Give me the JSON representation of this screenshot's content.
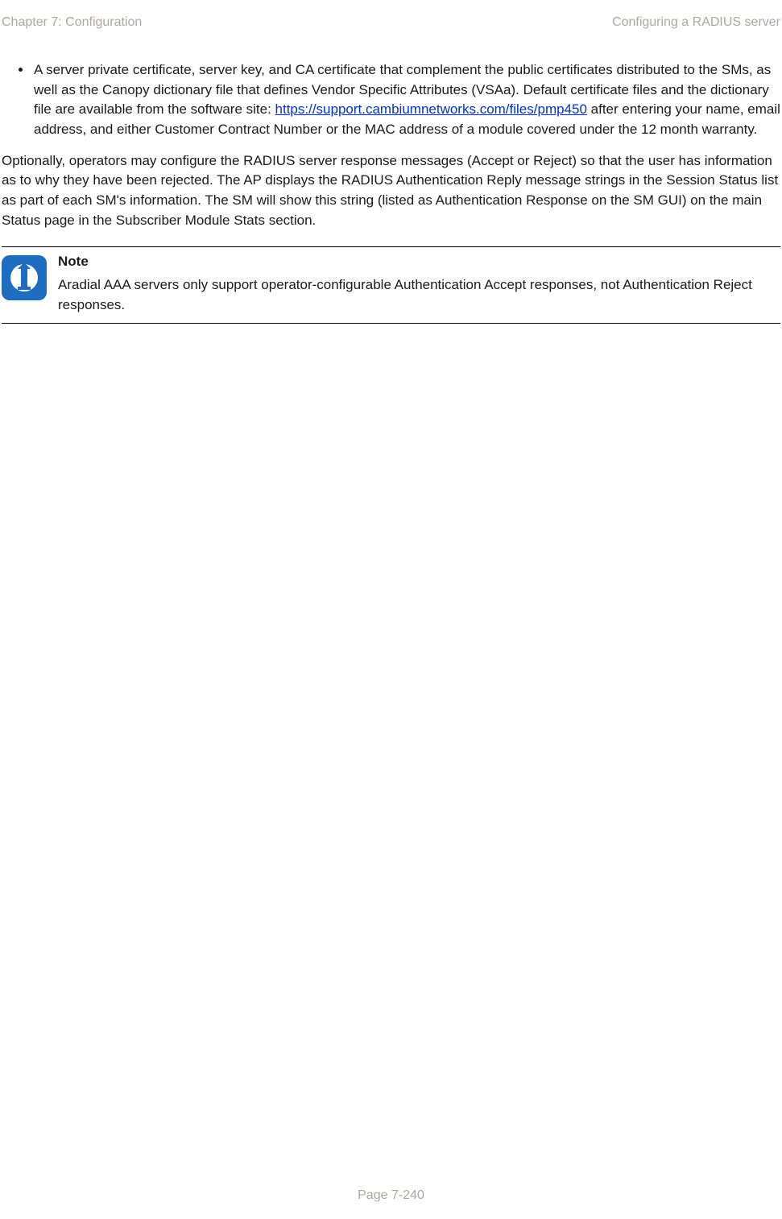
{
  "header": {
    "left": "Chapter 7:  Configuration",
    "right": "Configuring a RADIUS server"
  },
  "bullet": {
    "pre_link": "A server private certificate, server key, and CA certificate that complement the public certificates distributed to the SMs, as well as the Canopy dictionary file that defines Vendor Specific Attributes (VSAa). Default certificate files and the dictionary file are available from the software site: ",
    "link_text": "https://support.cambiumnetworks.com/files/pmp450",
    "post_link": " after entering your name, email address, and either Customer Contract Number or the MAC address of a module covered under the 12 month warranty."
  },
  "paragraph": "Optionally, operators may configure the RADIUS server response messages (Accept or Reject) so that the user has information as to why they have been rejected. The AP displays the RADIUS Authentication Reply message strings in the Session Status list as part of each SM's information. The SM will show this string (listed as Authentication Response on the SM GUI) on the main Status page in the Subscriber Module Stats section.",
  "note": {
    "heading": "Note",
    "body": "Aradial AAA servers only support operator-configurable Authentication Accept responses, not Authentication Reject responses."
  },
  "footer": "Page 7-240"
}
